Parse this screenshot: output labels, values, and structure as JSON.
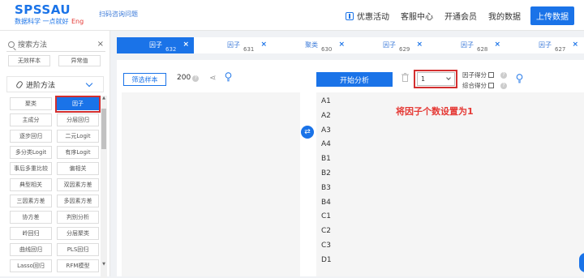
{
  "header": {
    "logo_main": "SPSSAU",
    "logo_sub": "数据科学 一点就好",
    "logo_eng": "Eng",
    "scan_link": "扫码咨询问题",
    "nav": [
      "优惠活动",
      "客服中心",
      "开通会员",
      "我的数据"
    ],
    "upload": "上传数据"
  },
  "sidebar": {
    "search_placeholder": "搜索方法",
    "search_clear": "×",
    "top_items": [
      "无效样本",
      "异常值"
    ],
    "section_title": "进阶方法",
    "methods": [
      [
        "聚类",
        "因子"
      ],
      [
        "主成分",
        "分层回归"
      ],
      [
        "逐步回归",
        "二元Logit"
      ],
      [
        "多分类Logit",
        "有序Logit"
      ],
      [
        "事后多重比较",
        "偏相关"
      ],
      [
        "典型相关",
        "双因素方差"
      ],
      [
        "三因素方差",
        "多因素方差"
      ],
      [
        "协方差",
        "判别分析"
      ],
      [
        "岭回归",
        "分层聚类"
      ],
      [
        "曲线回归",
        "PLS回归"
      ],
      [
        "Lasso回归",
        "RFM模型"
      ]
    ],
    "active_method": "因子",
    "scroll_up": "▲",
    "scroll_down": "▼"
  },
  "tabs": [
    {
      "name": "因子",
      "num": "632"
    },
    {
      "name": "因子",
      "num": "631"
    },
    {
      "name": "聚类",
      "num": "630"
    },
    {
      "name": "因子",
      "num": "629"
    },
    {
      "name": "因子",
      "num": "628"
    },
    {
      "name": "因子",
      "num": "627"
    }
  ],
  "tab_close": "×",
  "main": {
    "filter_btn": "筛选样本",
    "count": "200",
    "q": "?",
    "share_icon": "⋖",
    "swap_icon": "⇄",
    "start_btn": "开始分析",
    "factor_count": "1",
    "opt_score": "因子得分",
    "opt_composite": "综合得分",
    "annotation": "将因子个数设置为1",
    "variables": [
      "A1",
      "A2",
      "A3",
      "A4",
      "B1",
      "B2",
      "B3",
      "B4",
      "C1",
      "C2",
      "C3",
      "D1"
    ]
  }
}
